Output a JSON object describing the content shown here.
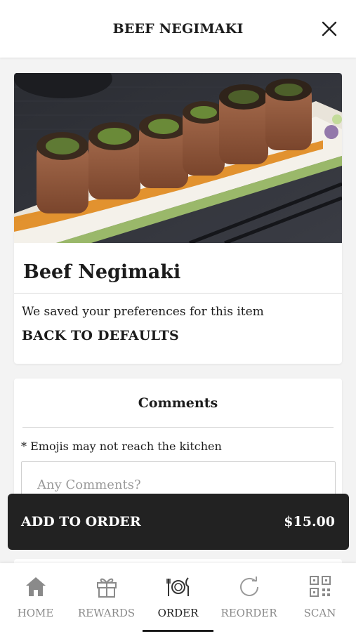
{
  "header": {
    "title": "BEEF NEGIMAKI",
    "close_icon": "close-icon"
  },
  "item": {
    "name": "Beef Negimaki",
    "image_icon": "beef-negimaki-photo",
    "preferences_text": "We saved your preferences for this item",
    "back_to_defaults_label": "BACK TO DEFAULTS"
  },
  "comments": {
    "title": "Comments",
    "note": "* Emojis may not reach the kitchen",
    "placeholder": "Any Comments?"
  },
  "add_to_order": {
    "label": "ADD TO ORDER",
    "price": "$15.00"
  },
  "tabbar": {
    "items": [
      {
        "label": "HOME",
        "icon": "home-icon"
      },
      {
        "label": "REWARDS",
        "icon": "gift-icon"
      },
      {
        "label": "ORDER",
        "icon": "utensils-icon"
      },
      {
        "label": "REORDER",
        "icon": "refresh-icon"
      },
      {
        "label": "SCAN",
        "icon": "qr-code-icon"
      }
    ],
    "active": "ORDER"
  },
  "colors": {
    "bar": "#222222",
    "active_tab": "#1c1c1c",
    "inactive_tab": "#8a8a8a",
    "sauce": "#e08a1e"
  }
}
